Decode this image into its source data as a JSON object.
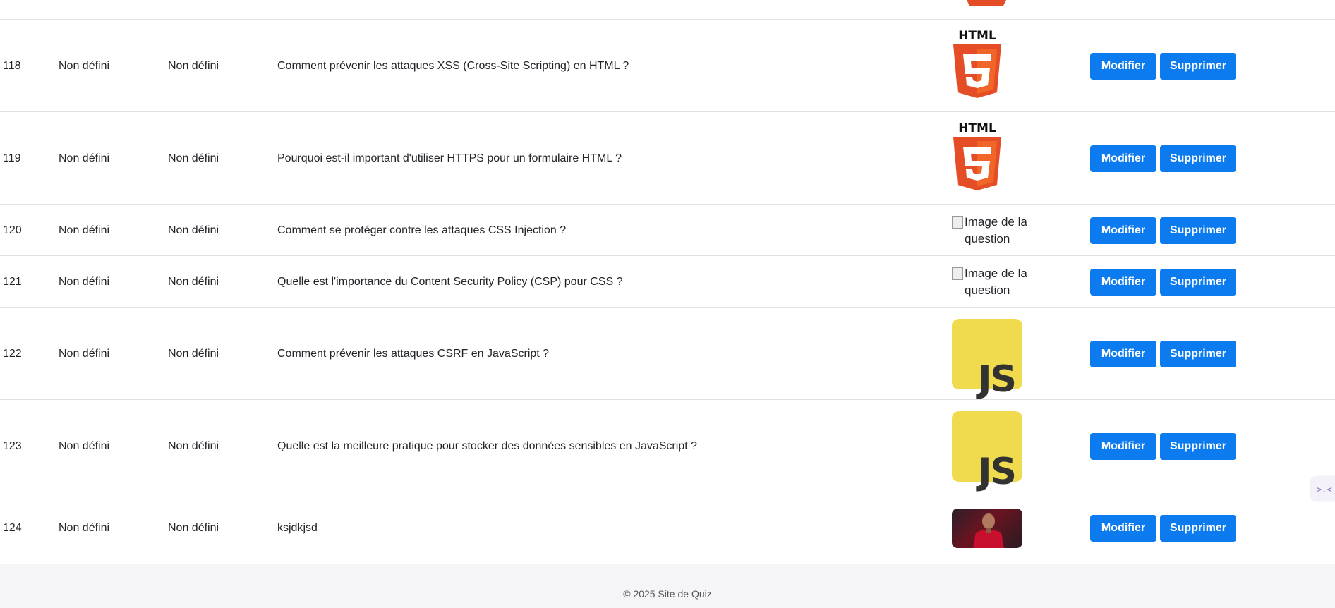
{
  "rows": [
    {
      "id": "118",
      "a": "Non défini",
      "b": "Non défini",
      "question": "Comment prévenir les attaques XSS (Cross-Site Scripting) en HTML ?",
      "image": "html5-logo",
      "image_text": "HTML",
      "modify": "Modifier",
      "delete": "Supprimer"
    },
    {
      "id": "119",
      "a": "Non défini",
      "b": "Non défini",
      "question": "Pourquoi est-il important d'utiliser HTTPS pour un formulaire HTML ?",
      "image": "html5-logo",
      "image_text": "HTML",
      "modify": "Modifier",
      "delete": "Supprimer"
    },
    {
      "id": "120",
      "a": "Non défini",
      "b": "Non défini",
      "question": "Comment se protéger contre les attaques CSS Injection ?",
      "image": "broken",
      "image_text": "Image de la question",
      "modify": "Modifier",
      "delete": "Supprimer"
    },
    {
      "id": "121",
      "a": "Non défini",
      "b": "Non défini",
      "question": "Quelle est l'importance du Content Security Policy (CSP) pour CSS ?",
      "image": "broken",
      "image_text": "Image de la question",
      "modify": "Modifier",
      "delete": "Supprimer"
    },
    {
      "id": "122",
      "a": "Non défini",
      "b": "Non défini",
      "question": "Comment prévenir les attaques CSRF en JavaScript ?",
      "image": "js-logo",
      "image_text": "JS",
      "modify": "Modifier",
      "delete": "Supprimer"
    },
    {
      "id": "123",
      "a": "Non défini",
      "b": "Non défini",
      "question": "Quelle est la meilleure pratique pour stocker des données sensibles en JavaScript ?",
      "image": "js-logo",
      "image_text": "JS",
      "modify": "Modifier",
      "delete": "Supprimer"
    },
    {
      "id": "124",
      "a": "Non défini",
      "b": "Non défini",
      "question": "ksjdkjsd",
      "image": "photo",
      "modify": "Modifier",
      "delete": "Supprimer"
    }
  ],
  "footer": {
    "text": "© 2025 Site de Quiz"
  },
  "colors": {
    "button": "#0d7bf0",
    "html_orange": "#e44d26",
    "js_yellow": "#f0db4f",
    "footer_bg": "#f5f5f7"
  }
}
